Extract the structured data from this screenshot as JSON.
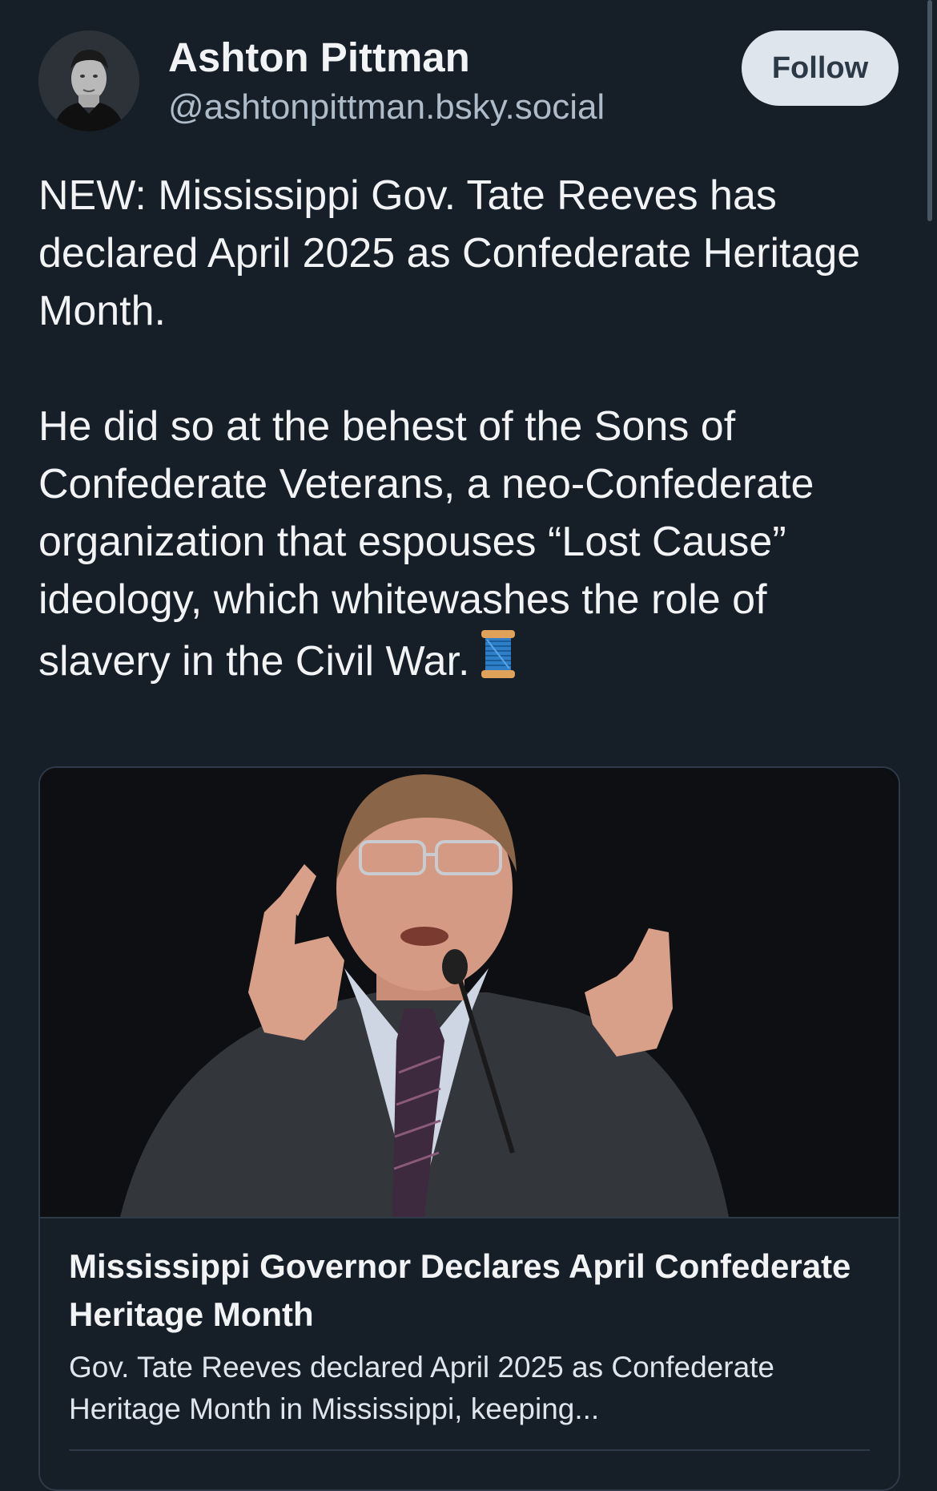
{
  "author": {
    "name": "Ashton Pittman",
    "handle": "@ashtonpittman.bsky.social"
  },
  "follow_label": "Follow",
  "post": {
    "paragraph1": "NEW: Mississippi Gov. Tate Reeves has declared April 2025 as Confederate Heritage Month.",
    "paragraph2": "He did so at the behest of the Sons of Confederate Veterans, a neo-Confederate organization that espouses “Lost Cause” ideology, which whitewashes the role of slavery in the Civil War.",
    "emoji_icon": "spool-of-thread-icon"
  },
  "link_card": {
    "title": "Mississippi Governor Declares April Confederate Heritage Month",
    "description": "Gov. Tate Reeves declared April 2025 as Confederate Heritage Month in Mississippi, keeping..."
  },
  "colors": {
    "background": "#161e27",
    "text": "#f1f3f5",
    "handle": "#aebbc9",
    "follow_bg": "#dfe5ec",
    "follow_text": "#2b3947",
    "border": "#2e3a48"
  }
}
